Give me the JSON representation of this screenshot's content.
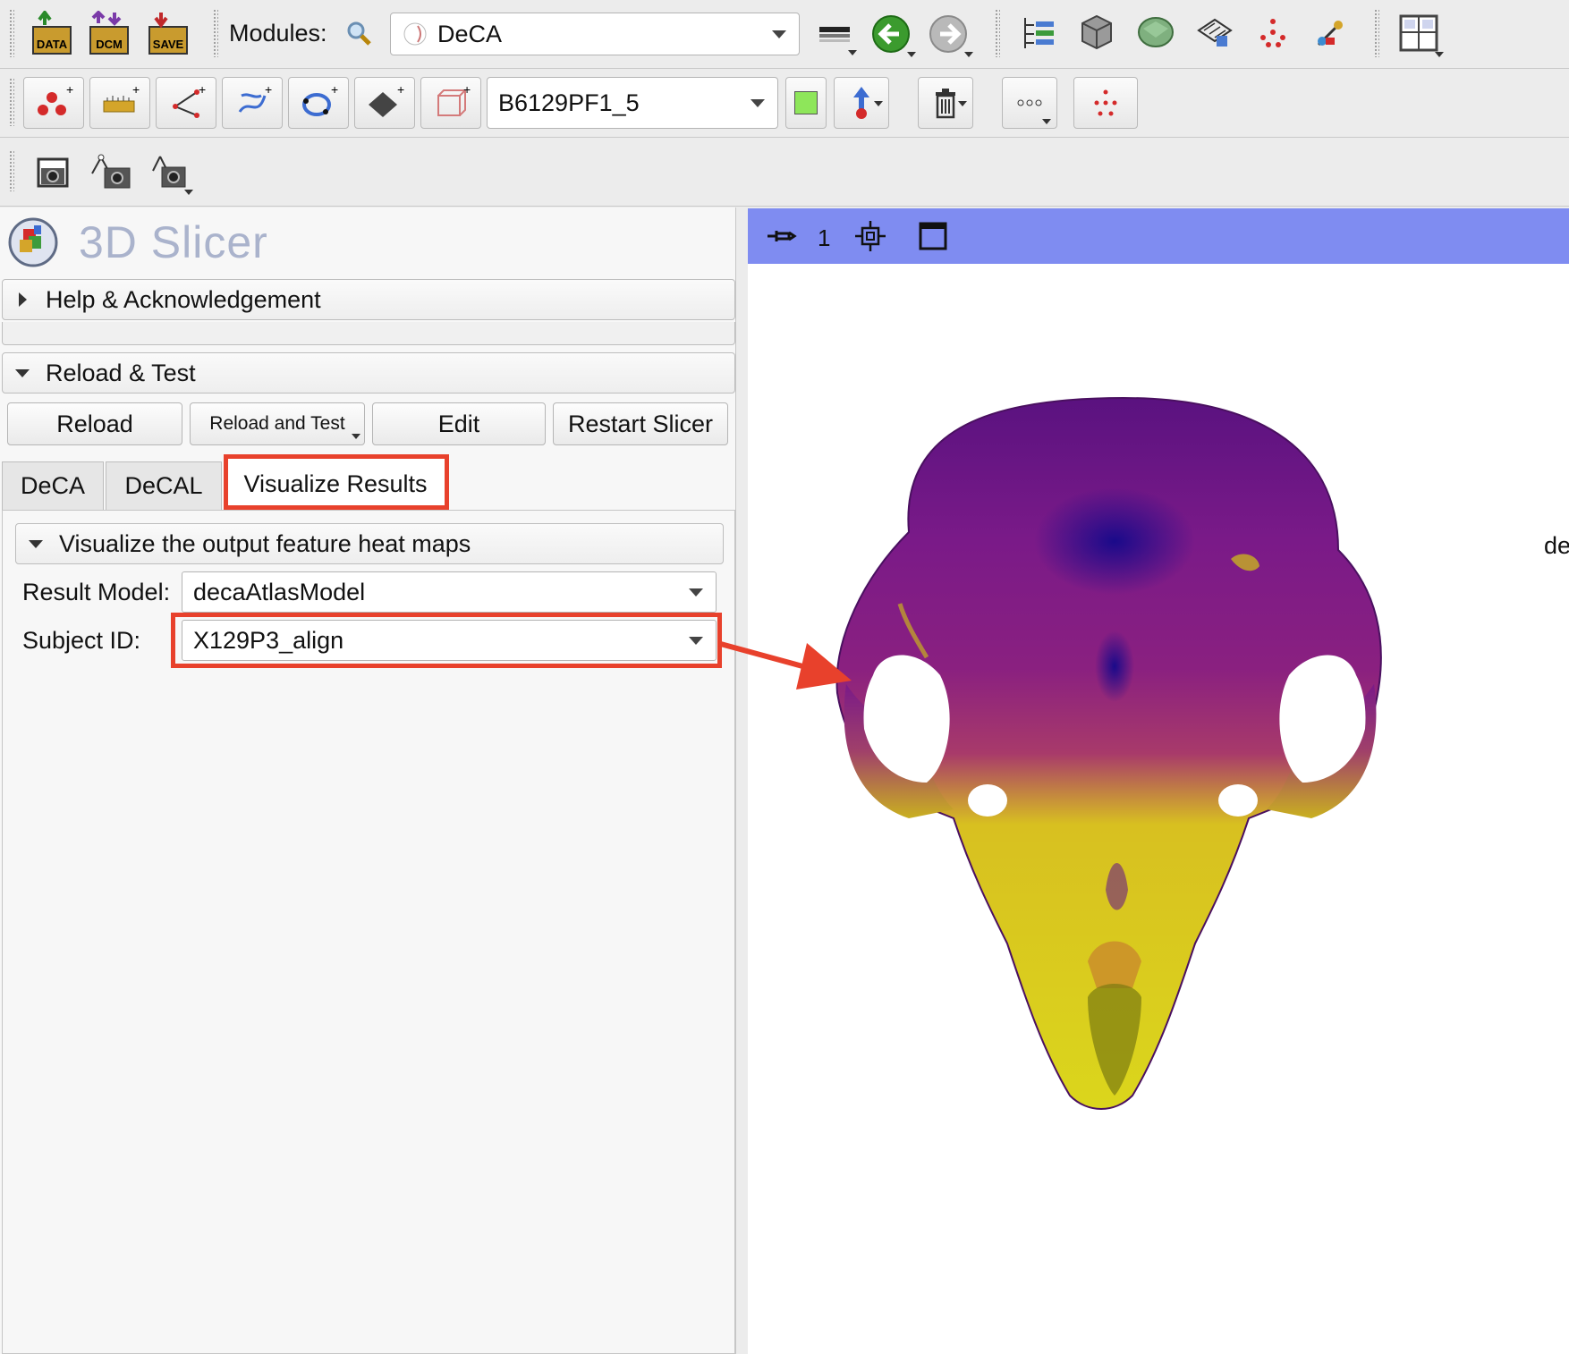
{
  "toolbar": {
    "data_icon_text": "DATA",
    "dcm_icon_text": "DCM",
    "save_icon_text": "SAVE",
    "modules_label": "Modules:",
    "module_selected": "DeCA",
    "node_selected": "B6129PF1_5"
  },
  "icons": [
    "data-icon",
    "dcm-icon",
    "save-icon",
    "search-icon",
    "module-combobox",
    "layout-toggle-icon",
    "back-arrow-icon",
    "forward-arrow-icon",
    "data-tree-icon",
    "volume-icon",
    "model-icon",
    "segment-icon",
    "markups-icon",
    "annotation-icon",
    "layout-icon",
    "point-list-icon",
    "line-icon",
    "angle-icon",
    "curve-icon",
    "closed-curve-icon",
    "plane-icon",
    "roi-icon",
    "node-color-icon",
    "place-mode-icon",
    "delete-icon",
    "more-icon",
    "markups-place-icon",
    "screenshot-icon",
    "screenshot-tree-icon",
    "screenshot-scene-icon",
    "pin-icon",
    "center-view-icon",
    "maximize-view-icon"
  ],
  "app": {
    "logo_text": "3D Slicer"
  },
  "panel": {
    "help_label": "Help & Acknowledgement",
    "reload_section_label": "Reload & Test",
    "buttons": {
      "reload": "Reload",
      "reload_and_test": "Reload and Test",
      "edit": "Edit",
      "restart": "Restart Slicer"
    },
    "tabs": [
      "DeCA",
      "DeCAL",
      "Visualize Results"
    ],
    "active_tab": "Visualize Results",
    "visualize_section_label": "Visualize the output feature heat maps",
    "result_model_label": "Result Model:",
    "result_model_value": "decaAtlasModel",
    "subject_id_label": "Subject ID:",
    "subject_id_value": "X129P3_align"
  },
  "viewer": {
    "view_number": "1",
    "clipped_text": "de",
    "bar_color": "#7f8cf1",
    "model_description": "skull model heat map"
  },
  "colors": {
    "highlight": "#e8412c",
    "heat_low": "#3d0a8c",
    "heat_mid": "#a0267a",
    "heat_high": "#e6e01a"
  }
}
